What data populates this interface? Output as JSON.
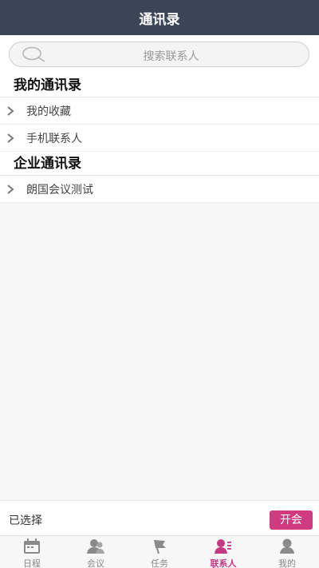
{
  "header": {
    "title": "通讯录"
  },
  "search": {
    "placeholder": "搜索联系人"
  },
  "sections": [
    {
      "title": "我的通讯录",
      "items": [
        {
          "label": "我的收藏"
        },
        {
          "label": "手机联系人"
        }
      ]
    },
    {
      "title": "企业通讯录",
      "items": [
        {
          "label": "朗国会议测试"
        }
      ]
    }
  ],
  "selection": {
    "label": "已选择",
    "button": "开会"
  },
  "tabbar": {
    "items": [
      {
        "label": "日程",
        "icon": "calendar-icon"
      },
      {
        "label": "会议",
        "icon": "meeting-icon"
      },
      {
        "label": "任务",
        "icon": "flag-icon"
      },
      {
        "label": "联系人",
        "icon": "contacts-icon"
      },
      {
        "label": "我的",
        "icon": "person-icon"
      }
    ],
    "active_index": 3
  },
  "colors": {
    "header_bg": "#3b4558",
    "accent": "#c43a82",
    "button_bg": "#d03b80"
  }
}
